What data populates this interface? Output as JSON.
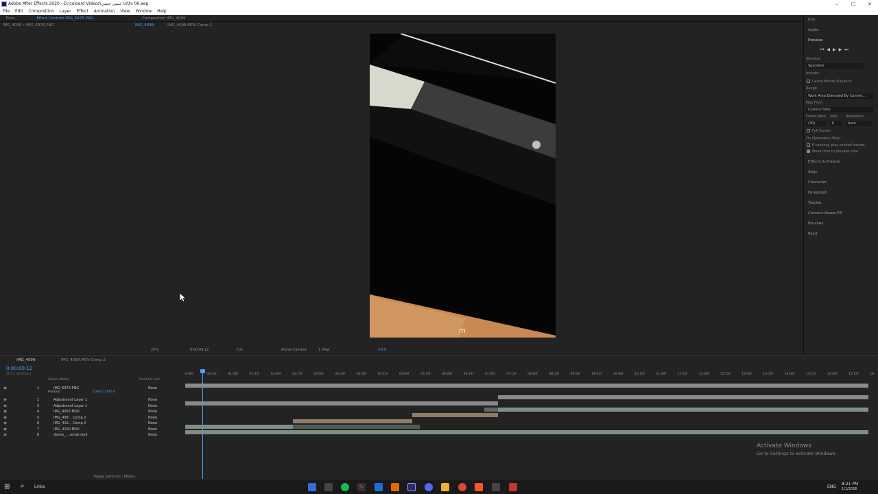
{
  "titlebar": {
    "title": "Adobe After Effects 2020 - D:\\coloerd Videos\\حبيبي حبيبي UI\\tv 06.aep"
  },
  "menu": [
    "File",
    "Edit",
    "Composition",
    "Layer",
    "Effect",
    "Animation",
    "View",
    "Window",
    "Help"
  ],
  "left_panel": {
    "tab_tools": "Tools",
    "tab_effect": "Effect Controls IMG_6976.PNG",
    "subtitle": "IMG_4099 • IMG_6976.PNG"
  },
  "comp_panel": {
    "tab": "Composition IMG_4099",
    "crumb1": "IMG_4099",
    "crumb2": "IMG_4099.MOV Comp 2"
  },
  "viewer_bar": {
    "zoom": "25%",
    "time": "0:00:00:12",
    "quality": "Full",
    "camera": "Active Camera",
    "views": "1 View",
    "exposure": "+0.0"
  },
  "right_panel": {
    "info": "Info",
    "audio": "Audio",
    "preview": "Preview",
    "shortcut_label": "Shortcut",
    "shortcut_value": "Spacebar",
    "include_label": "Include:",
    "cache_label": "Cache Before Playback",
    "range_label": "Range",
    "range_value": "Work Area Extended By Current...",
    "play_from_label": "Play From",
    "play_from_value": "Current Time",
    "frame_rate_label": "Frame Rate",
    "skip_label": "Skip",
    "resolution_label": "Resolution",
    "frame_rate_value": "(30)",
    "skip_value": "0",
    "resolution_value": "Auto",
    "full_screen": "Full Screen",
    "stop_label": "On (Spacebar) Stop:",
    "stop_opt1": "If caching, play cached frames",
    "stop_opt2": "Move time to preview time",
    "sections": [
      "Effects & Presets",
      "Align",
      "Character",
      "Paragraph",
      "Tracker",
      "Content-Aware Fill",
      "Brushes",
      "Paint"
    ]
  },
  "timeline": {
    "tab1": "IMG_4099",
    "tab2": "IMG_4099.MOV Comp 2",
    "current_time": "0:00:00:12",
    "fps_sub": "00012 (30.00 fps)",
    "col_source": "Source Name",
    "col_parent": "Parent & Link",
    "position_label": "Position",
    "position_value": "1080.0,1740.0",
    "toggle_label": "Toggle Switches / Modes",
    "ruler": [
      "0:00f",
      "00:15f",
      "01:00f",
      "01:15f",
      "02:00f",
      "02:15f",
      "03:00f",
      "03:15f",
      "04:00f",
      "04:15f",
      "05:00f",
      "05:15f",
      "06:00f",
      "06:15f",
      "07:00f",
      "07:15f",
      "08:00f",
      "08:15f",
      "09:00f",
      "09:15f",
      "10:00f",
      "10:15f",
      "11:00f",
      "11:15f",
      "12:00f",
      "12:15f",
      "13:00f",
      "13:15f",
      "14:00f",
      "14:15f",
      "15:00f",
      "15:15f",
      "16"
    ],
    "layers": [
      {
        "num": "1",
        "name": "IMG_6976.PNG",
        "parent": "None"
      },
      {
        "num": "2",
        "name": "Adjustment Layer 1",
        "parent": "None"
      },
      {
        "num": "3",
        "name": "Adjustment Layer 1",
        "parent": "None"
      },
      {
        "num": "4",
        "name": "IMG_4093.MOV",
        "parent": "None"
      },
      {
        "num": "5",
        "name": "IMG_409... Comp 2",
        "parent": "None"
      },
      {
        "num": "6",
        "name": "IMG_410... Comp 2",
        "parent": "None"
      },
      {
        "num": "7",
        "name": "IMG_4100.MOV",
        "parent": "None"
      },
      {
        "num": "8",
        "name": "desire_....ental.mp3",
        "parent": "None"
      }
    ]
  },
  "watermark": {
    "line1": "Activate Windows",
    "line2": "Go to Settings to activate Windows."
  },
  "taskbar": {
    "search": "Links",
    "lang": "ENG",
    "time": "8:21 PM",
    "date": "1/1/2026"
  },
  "colors": {
    "accent": "#4da3ff",
    "timeline_bar": "#8a8a8a",
    "audio_bar": "#7f8f86",
    "tan_bar": "#8f7c68"
  }
}
